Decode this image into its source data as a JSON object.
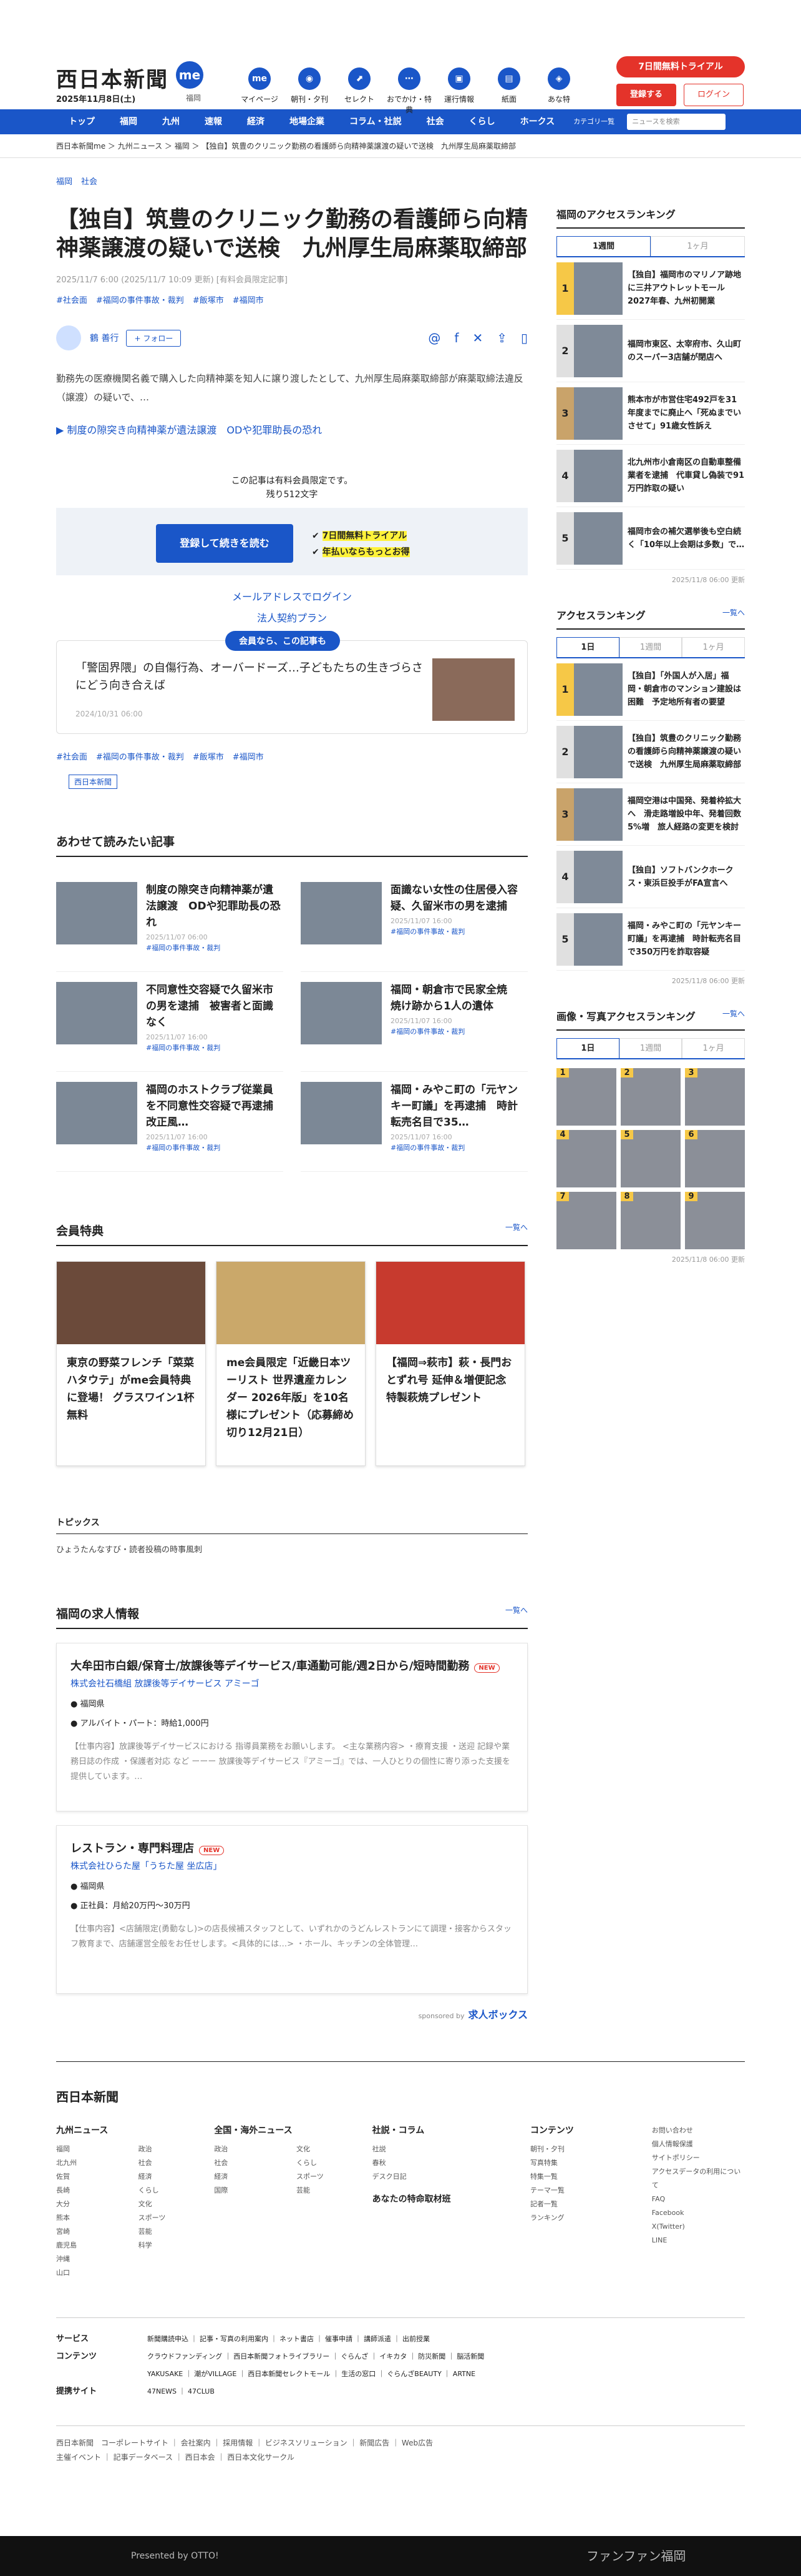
{
  "header": {
    "logo": "西日本新聞",
    "me": "me",
    "date": "2025年11月8日(土)",
    "region": "福岡",
    "icons": [
      "マイページ",
      "朝刊・夕刊",
      "セレクト",
      "おでかけ・特典",
      "運行情報",
      "紙面",
      "あな特"
    ],
    "trial": "7日間無料トライアル",
    "register": "登録する",
    "login": "ログイン"
  },
  "nav": {
    "items": [
      "トップ",
      "福岡",
      "九州",
      "速報",
      "経済",
      "地場企業",
      "コラム・社説",
      "社会",
      "くらし",
      "ホークス"
    ],
    "category": "カテゴリ一覧",
    "search_placeholder": "ニュースを検索"
  },
  "breadcrumb": "西日本新聞me ＞ 九州ニュース ＞ 福岡 ＞ 【独自】筑豊のクリニック勤務の看護師ら向精神薬譲渡の疑いで送検　九州厚生局麻薬取締部",
  "article": {
    "top_tags": [
      "福岡",
      "社会"
    ],
    "title": "【独自】筑豊のクリニック勤務の看護師ら向精神薬譲渡の疑いで送検　九州厚生局麻薬取締部",
    "meta": "2025/11/7 6:00 (2025/11/7 10:09 更新) [有料会員限定記事]",
    "tags": [
      "#社会面",
      "#福岡の事件事故・裁判",
      "#飯塚市",
      "#福岡市"
    ],
    "author": "鶴 善行",
    "follow": "+ フォロー",
    "lead": "勤務先の医療機関名義で購入した向精神薬を知人に譲り渡したとして、九州厚生局麻薬取締部が麻薬取締法違反（譲渡）の疑いで、…",
    "related": "▶ 制度の隙突き向精神薬が遺法譲渡　ODや犯罪助長の恐れ",
    "paynote": "この記事は有料会員限定です。",
    "remaining": "残り512文字",
    "cta": "登録して続きを読む",
    "hl1": "7日間無料トライアル",
    "hl2": "年払いならもっとお得",
    "mail_login": "メールアドレスでログイン",
    "corp_plan": "法人契約プラン",
    "member_label": "会員なら、この記事も",
    "member_title": "「警固界隈」の自傷行為、オーバードーズ…子どもたちの生きづらさにどう向き合えば",
    "member_date": "2024/10/31 06:00",
    "bottom_tags": [
      "#社会面",
      "#福岡の事件事故・裁判",
      "#飯塚市",
      "#福岡市"
    ],
    "paper": "西日本新聞"
  },
  "related_section": {
    "title": "あわせて読みたい記事",
    "items": [
      {
        "title": "制度の隙突き向精神薬が遺法譲渡　ODや犯罪助長の恐れ",
        "date": "2025/11/07 06:00",
        "tag": "#福岡の事件事故・裁判"
      },
      {
        "title": "面識ない女性の住居侵入容疑、久留米市の男を逮捕",
        "date": "2025/11/07 16:00",
        "tag": "#福岡の事件事故・裁判"
      },
      {
        "title": "不同意性交容疑で久留米市の男を逮捕　被害者と面識なく",
        "date": "2025/11/07 16:00",
        "tag": "#福岡の事件事故・裁判"
      },
      {
        "title": "福岡・朝倉市で民家全焼　焼け跡から1人の遺体",
        "date": "2025/11/07 16:00",
        "tag": "#福岡の事件事故・裁判"
      },
      {
        "title": "福岡のホストクラブ従業員を不同意性交容疑で再逮捕　改正風…",
        "date": "2025/11/07 16:00",
        "tag": "#福岡の事件事故・裁判"
      },
      {
        "title": "福岡・みやこ町の「元ヤンキー町議」を再逮捕　時計転売名目で35…",
        "date": "2025/11/07 16:00",
        "tag": "#福岡の事件事故・裁判"
      }
    ]
  },
  "perks": {
    "title": "会員特典",
    "more": "一覧へ",
    "items": [
      "東京の野菜フレンチ「菜菜ハタウテ」がme会員特典に登場！ グラスワイン1杯無料",
      "me会員限定「近畿日本ツーリスト 世界遺産カレンダー 2026年版」を10名様にプレゼント（応募締め切り12月21日）",
      "【福岡⇒萩市】萩・長門おとずれ号 延伸＆増便記念 特製萩焼プレゼント"
    ]
  },
  "topics": {
    "title": "トピックス",
    "item": "ひょうたんなすび・読者投稿の時事風刺"
  },
  "jobs": {
    "title": "福岡の求人情報",
    "more": "一覧へ",
    "items": [
      {
        "title": "大牟田市白銀/保育士/放課後等デイサービス/車通勤可能/週2日から/短時間勤務",
        "company": "株式会社石橋組 放課後等デイサービス アミーゴ",
        "place": "福岡県",
        "pay": "アルバイト・パート：時給1,000円",
        "desc": "【仕事内容】放課後等デイサービスにおける 指導員業務をお願いします。 <主な業務内容> ・療育支援 ・送迎 記録や業務日誌の作成 ・保護者対応 など ーーー 放課後等デイサービス『アミーゴ』では、一人ひとりの個性に寄り添った支援を提供しています。…"
      },
      {
        "title": "レストラン・専門料理店",
        "company": "株式会社ひらた屋「うちた屋 坐広店」",
        "place": "福岡県",
        "pay": "正社員：月給20万円〜30万円",
        "desc": "【仕事内容】<店舗限定(勇動なし)>の店長候補スタッフとして、いずれかのうどんレストランにて調理・接客からスタッフ教育まで、店舗運営全般をお任せします。<具体的には…> ・ホール、キッチンの全体管理…"
      }
    ],
    "sponsor": "sponsored by",
    "sponsor_brand": "求人ボックス"
  },
  "sidebar": {
    "access_title": "福岡のアクセスランキング",
    "tab_week": "1週間",
    "tab_month": "1ヶ月",
    "rank1": [
      "【独自】福岡市のマリノア跡地に三井アウトレットモール　2027年春、九州初開業",
      "福岡市東区、太宰府市、久山町のスーパー3店舗が閉店へ",
      "熊本市が市営住宅492戸を31年度までに廃止へ「死ぬまでいさせて」91歳女性訴え",
      "北九州市小倉南区の自動車整備業者を逮捕　代車貸し偽装で91万円詐取の疑い",
      "福岡市会の補欠選挙後も空白続く「10年以上会期は多数」で…"
    ],
    "update1": "2025/11/8 06:00 更新",
    "access2_title": "アクセスランキング",
    "more": "一覧へ",
    "tab_day": "1日",
    "rank2": [
      "【独自】「外国人が入居」福岡・朝倉市のマンション建設は困難　予定地所有者の要望",
      "【独自】筑豊のクリニック勤務の看護師ら向精神薬譲渡の疑いで送検　九州厚生局麻薬取締部",
      "福岡空港は中国発、発着枠拡大へ　滑走路増設中年、発着回数5%増　旅人経路の変更を検討",
      "【独自】ソフトバンクホークス・東浜巨投手がFA宣言へ",
      "福岡・みやこ町の「元ヤンキー町議」を再逮捕　時計転売名目で350万円を詐取容疑"
    ],
    "update2": "2025/11/8 06:00 更新",
    "photo_title": "画像・写真アクセスランキング",
    "photo_nums": [
      "1",
      "2",
      "3",
      "4",
      "5",
      "6",
      "7",
      "8",
      "9"
    ],
    "update3": "2025/11/8 06:00 更新"
  },
  "footer": {
    "logo": "西日本新聞",
    "kyushu_title": "九州ニュース",
    "kyushu": [
      "福岡",
      "北九州",
      "佐賀",
      "長崎",
      "大分",
      "熊本",
      "宮崎",
      "鹿児島",
      "沖縄",
      "山口"
    ],
    "kyushu2": [
      "政治",
      "社会",
      "経済",
      "くらし",
      "文化",
      "スポーツ",
      "芸能",
      "科学"
    ],
    "national_title": "全国・海外ニュース",
    "national": [
      "政治",
      "社会",
      "経済",
      "国際",
      "文化",
      "くらし",
      "スポーツ",
      "芸能"
    ],
    "column_title": "社説・コラム",
    "column": [
      "社説",
      "春秋",
      "デスク日記"
    ],
    "your_title": "あなたの特命取材班",
    "contents_title": "コンテンツ",
    "contents": [
      "朝刊・夕刊",
      "写真特集",
      "特集一覧",
      "テーマ一覧",
      "記者一覧",
      "ランキング"
    ],
    "side": [
      "お問い合わせ",
      "個人情報保護",
      "サイトポリシー",
      "アクセスデータの利用について",
      "FAQ",
      "Facebook",
      "X(Twitter)",
      "LINE"
    ],
    "services_label": "サービス",
    "services": "新聞購読申込 ｜ 記事・写真の利用案内 ｜ ネット書店 ｜ 催事申請 ｜ 講師派遣 ｜ 出前授業",
    "contents_label": "コンテンツ",
    "contents_row": "クラウドファンディング ｜ 西日本新聞フォトライブラリー ｜ ぐらんざ ｜ イキカタ ｜ 防災新聞 ｜ 脳活新聞",
    "contents_row2": "YAKUSAKE ｜ 潮がVILLAGE ｜ 西日本新聞セレクトモール ｜ 生活の窓口 ｜ ぐらんざBEAUTY ｜ ARTNE",
    "related_label": "提携サイト",
    "related_row": "47NEWS ｜ 47CLUB",
    "bottom1": "西日本新聞　コーポレートサイト ｜ 会社案内 ｜ 採用情報 ｜ ビジネスソリューション ｜ 新聞広告 ｜ Web広告",
    "bottom2": "主催イベント ｜ 記事データベース ｜ 西日本会 ｜ 西日本文化サークル",
    "black_left": "Presented by OTTO!",
    "black_right": "ファンファン福岡"
  }
}
